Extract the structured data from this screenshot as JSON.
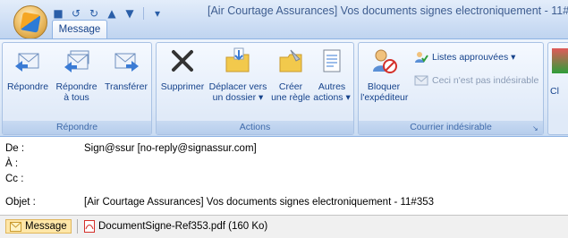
{
  "window": {
    "title": "[Air Courtage Assurances] Vos documents signes electroniquement - 11#"
  },
  "quick_access": {
    "items": [
      "save-icon",
      "undo-icon",
      "redo-icon",
      "up-icon",
      "down-icon",
      "customize-icon"
    ]
  },
  "ribbon": {
    "tab_label": "Message",
    "groups": {
      "repondre": {
        "label": "Répondre",
        "buttons": {
          "reply": "Répondre",
          "reply_all_1": "Répondre",
          "reply_all_2": "à tous",
          "forward": "Transférer"
        }
      },
      "actions": {
        "label": "Actions",
        "buttons": {
          "delete": "Supprimer",
          "move_1": "Déplacer vers",
          "move_2": "un dossier ▾",
          "rule_1": "Créer",
          "rule_2": "une règle",
          "other_1": "Autres",
          "other_2": "actions ▾"
        }
      },
      "junk": {
        "label": "Courrier indésirable",
        "buttons": {
          "block_1": "Bloquer",
          "block_2": "l'expéditeur",
          "approved": "Listes approuvées ▾",
          "not_junk": "Ceci n'est pas indésirable"
        }
      },
      "next_group_partial": "Cl"
    }
  },
  "message": {
    "from_label": "De :",
    "from_value": "Sign@ssur [no-reply@signassur.com]",
    "to_label": "À :",
    "to_value": "",
    "cc_label": "Cc :",
    "cc_value": "",
    "subject_label": "Objet :",
    "subject_value": "[Air Courtage Assurances] Vos documents signes electroniquement - 11#353"
  },
  "attachments": {
    "message_label": "Message",
    "file_label": "DocumentSigne-Ref353.pdf (160 Ko)"
  },
  "colors": {
    "ribbon_text": "#15428b",
    "accent_blue": "#8db2e3",
    "pdf_red": "#d4302a"
  }
}
